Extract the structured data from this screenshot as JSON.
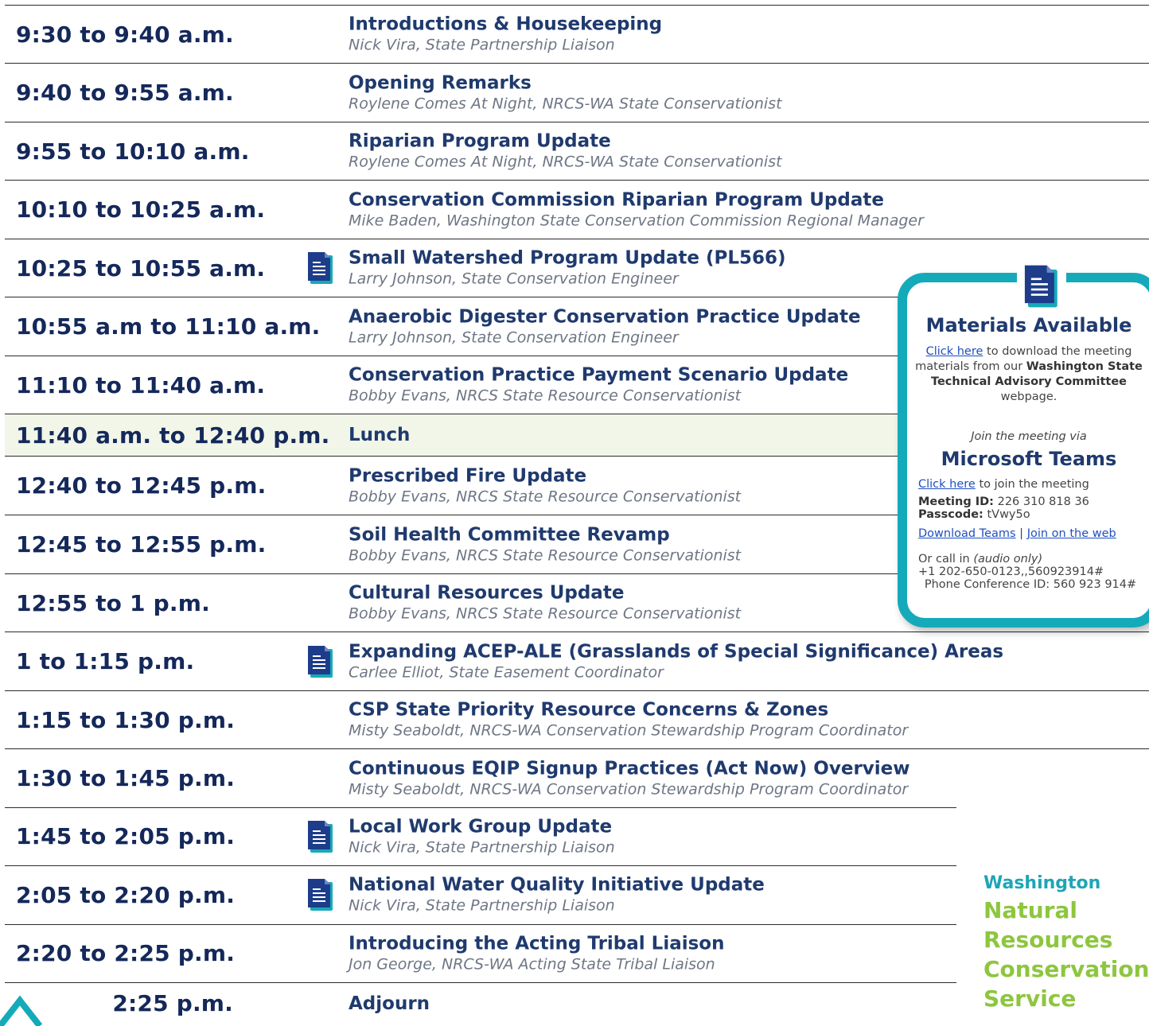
{
  "agenda": [
    {
      "time": "9:30 to 9:40 a.m.",
      "title": "Introductions & Housekeeping",
      "speaker": "Nick Vira, State Partnership Liaison",
      "icon": false
    },
    {
      "time": "9:40 to 9:55 a.m.",
      "title": "Opening Remarks",
      "speaker": "Roylene Comes At Night, NRCS-WA State Conservationist",
      "icon": false
    },
    {
      "time": "9:55 to 10:10 a.m.",
      "title": "Riparian Program Update",
      "speaker": "Roylene Comes At Night, NRCS-WA State Conservationist",
      "icon": false
    },
    {
      "time": "10:10 to 10:25 a.m.",
      "title": "Conservation Commission Riparian Program Update",
      "speaker": "Mike Baden, Washington State Conservation Commission Regional Manager",
      "icon": false
    },
    {
      "time": "10:25 to 10:55 a.m.",
      "title": "Small Watershed Program Update (PL566)",
      "speaker": "Larry Johnson, State Conservation Engineer",
      "icon": true
    },
    {
      "time": "10:55 a.m to 11:10 a.m.",
      "title": "Anaerobic Digester Conservation Practice Update",
      "speaker": "Larry Johnson, State Conservation Engineer",
      "icon": false
    },
    {
      "time": "11:10 to 11:40 a.m.",
      "title": "Conservation Practice Payment Scenario Update",
      "speaker": "Bobby Evans, NRCS State Resource Conservationist",
      "icon": false
    },
    {
      "time": "11:40 a.m. to 12:40 p.m.",
      "title": "Lunch",
      "speaker": "",
      "icon": false,
      "lunch": true
    },
    {
      "time": "12:40 to 12:45 p.m.",
      "title": "Prescribed Fire Update",
      "speaker": "Bobby Evans, NRCS State Resource Conservationist",
      "icon": false
    },
    {
      "time": "12:45 to 12:55 p.m.",
      "title": "Soil Health Committee Revamp",
      "speaker": "Bobby Evans, NRCS State Resource Conservationist",
      "icon": false
    },
    {
      "time": "12:55 to 1 p.m.",
      "title": "Cultural Resources Update",
      "speaker": "Bobby Evans, NRCS State Resource Conservationist",
      "icon": false
    },
    {
      "time": "1 to 1:15 p.m.",
      "title": "Expanding ACEP-ALE (Grasslands of Special Significance) Areas",
      "speaker": "Carlee Elliot, State Easement Coordinator",
      "icon": true
    },
    {
      "time": "1:15 to 1:30 p.m.",
      "title": "CSP State Priority Resource Concerns & Zones",
      "speaker": "Misty Seaboldt, NRCS-WA Conservation Stewardship Program Coordinator",
      "icon": false
    },
    {
      "time": "1:30 to 1:45 p.m.",
      "title": "Continuous EQIP Signup Practices (Act Now) Overview",
      "speaker": "Misty Seaboldt, NRCS-WA Conservation Stewardship Program Coordinator",
      "icon": false
    },
    {
      "time": "1:45 to 2:05 p.m.",
      "title": "Local Work Group Update",
      "speaker": "Nick Vira, State Partnership Liaison",
      "icon": true
    },
    {
      "time": "2:05 to 2:20 p.m.",
      "title": "National Water Quality Initiative Update",
      "speaker": "Nick Vira, State Partnership Liaison",
      "icon": true
    },
    {
      "time": "2:20 to 2:25 p.m.",
      "title": "Introducing the Acting Tribal Liaison",
      "speaker": "Jon George, NRCS-WA Acting State Tribal Liaison",
      "icon": false
    },
    {
      "time": "2:25 p.m.",
      "title": "Adjourn",
      "speaker": "",
      "icon": false,
      "align_right": true
    }
  ],
  "materials": {
    "heading": "Materials Available",
    "click_here": "Click here",
    "download_text": " to download the meeting materials from our ",
    "site_bold": "Washington State Technical Advisory Committee",
    "webpage_text": " webpage.",
    "join_via": "Join the meeting via",
    "teams_heading": "Microsoft Teams",
    "join_link": "Click here",
    "join_text": " to join the meeting",
    "meeting_id_label": "Meeting ID:",
    "meeting_id": " 226 310 818 36",
    "passcode_label": "Passcode:",
    "passcode": " tVwy5o",
    "download_teams": "Download Teams",
    "separator": " | ",
    "join_web": "Join on the web",
    "call_in": "Or call in ",
    "audio_only": "(audio only)",
    "phone": "+1 202-650-0123,,560923914#",
    "conf_id": "Phone Conference ID: 560 923 914#"
  },
  "logo": {
    "state": "Washington",
    "line1": "Natural",
    "line2": "Resources",
    "line3": "Conservation",
    "line4": "Service"
  },
  "colors": {
    "navy": "#14285a",
    "teal": "#15aab9",
    "green": "#8dc63f",
    "lunch_bg": "#f1f6e8"
  }
}
